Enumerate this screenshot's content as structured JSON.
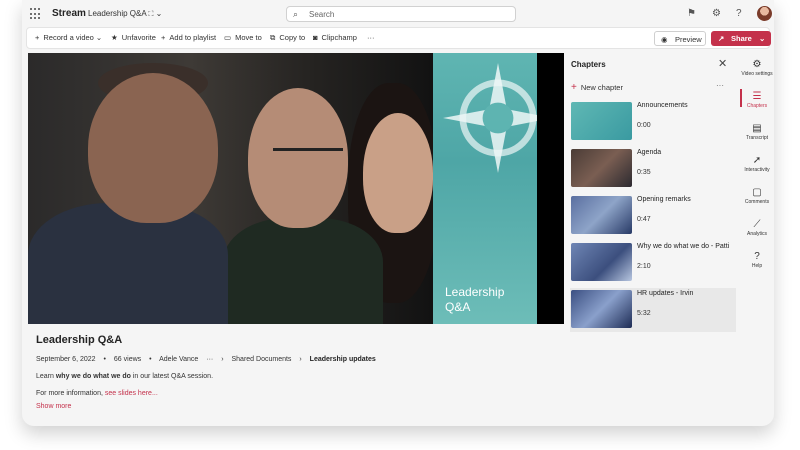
{
  "app": {
    "name": "Stream",
    "breadcrumb": "Leadership Q&A",
    "breadcrumb_chevron": "⌄"
  },
  "search": {
    "placeholder": "Search"
  },
  "toolbar": {
    "record": "Record a video",
    "unfavorite": "Unfavorite",
    "add_playlist": "Add to playlist",
    "move_to": "Move to",
    "copy_to": "Copy to",
    "clipchamp": "Clipchamp",
    "more": "···",
    "preview": "Preview",
    "share": "Share"
  },
  "video": {
    "slide_title_line1": "Leadership",
    "slide_title_line2": "Q&A",
    "title": "Leadership Q&A",
    "date": "September 6, 2022",
    "views": "66 views",
    "author": "Adele Vance",
    "path_more": "···",
    "path_1": "Shared Documents",
    "path_2": "Leadership updates",
    "desc_prefix": "Learn ",
    "desc_bold": "why we do what we do",
    "desc_suffix": " in our latest Q&A session.",
    "info_prefix": "For more information, ",
    "info_link": "see slides here...",
    "show_more": "Show more"
  },
  "chapters": {
    "title": "Chapters",
    "new_chapter": "New chapter",
    "more": "···",
    "items": [
      {
        "name": "Announcements",
        "time": "0:00"
      },
      {
        "name": "Agenda",
        "time": "0:35"
      },
      {
        "name": "Opening remarks",
        "time": "0:47"
      },
      {
        "name": "Why we do what we do - Patti",
        "time": "2:10"
      },
      {
        "name": "HR updates - Irvin",
        "time": "5:32"
      }
    ]
  },
  "rail": {
    "video_settings": "Video settings",
    "chapters": "Chapters",
    "transcript": "Transcript",
    "interactivity": "Interactivity",
    "comments": "Comments",
    "analytics": "Analytics",
    "help": "Help"
  },
  "colors": {
    "accent": "#c4314b",
    "slide_teal": "#5fb5b2"
  }
}
